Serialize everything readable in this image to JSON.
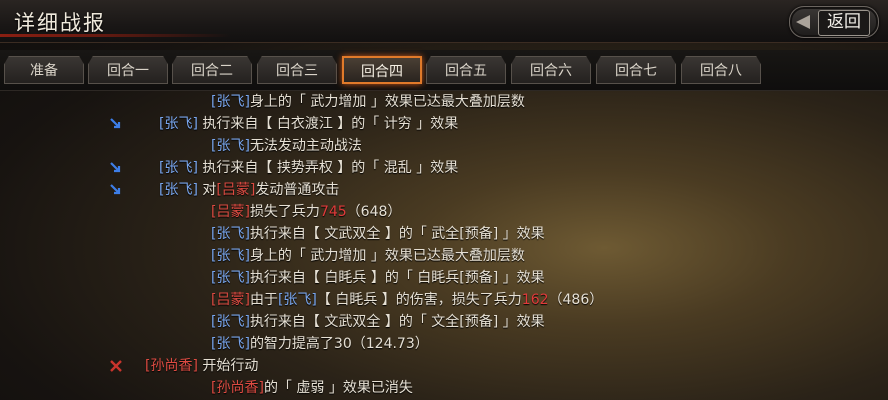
{
  "header": {
    "title": "详细战报",
    "back_label": "返回"
  },
  "tabs": [
    {
      "label": "准备",
      "active": false
    },
    {
      "label": "回合一",
      "active": false
    },
    {
      "label": "回合二",
      "active": false
    },
    {
      "label": "回合三",
      "active": false
    },
    {
      "label": "回合四",
      "active": true
    },
    {
      "label": "回合五",
      "active": false
    },
    {
      "label": "回合六",
      "active": false
    },
    {
      "label": "回合七",
      "active": false
    },
    {
      "label": "回合八",
      "active": false
    }
  ],
  "log": [
    {
      "icon": null,
      "segments": [
        {
          "t": "[张飞]",
          "c": "blue"
        },
        {
          "t": "身上的「 武力增加 」效果已达最大叠加层数",
          "c": "plain"
        }
      ]
    },
    {
      "icon": "debuff-arrow-icon",
      "segments": [
        {
          "t": "[张飞]",
          "c": "blue"
        },
        {
          "t": " 执行来自【 白衣渡江 】的「 计穷 」效果",
          "c": "plain"
        }
      ]
    },
    {
      "icon": null,
      "segments": [
        {
          "t": "[张飞]",
          "c": "blue"
        },
        {
          "t": "无法发动主动战法",
          "c": "plain"
        }
      ]
    },
    {
      "icon": "debuff-arrow-icon",
      "segments": [
        {
          "t": "[张飞]",
          "c": "blue"
        },
        {
          "t": " 执行来自【 挟势弄权 】的「 混乱 」效果",
          "c": "plain"
        }
      ]
    },
    {
      "icon": "debuff-arrow-icon",
      "segments": [
        {
          "t": "[张飞]",
          "c": "blue"
        },
        {
          "t": " 对",
          "c": "plain"
        },
        {
          "t": "[吕蒙]",
          "c": "red"
        },
        {
          "t": "发动普通攻击",
          "c": "plain"
        }
      ]
    },
    {
      "icon": null,
      "segments": [
        {
          "t": "[吕蒙]",
          "c": "red"
        },
        {
          "t": "损失了兵力",
          "c": "plain"
        },
        {
          "t": "745",
          "c": "numred"
        },
        {
          "t": "（648）",
          "c": "plain"
        }
      ]
    },
    {
      "icon": null,
      "segments": [
        {
          "t": "[张飞]",
          "c": "blue"
        },
        {
          "t": "执行来自【 文武双全 】的「 武全[预备] 」效果",
          "c": "plain"
        }
      ]
    },
    {
      "icon": null,
      "segments": [
        {
          "t": "[张飞]",
          "c": "blue"
        },
        {
          "t": "身上的「 武力增加 」效果已达最大叠加层数",
          "c": "plain"
        }
      ]
    },
    {
      "icon": null,
      "segments": [
        {
          "t": "[张飞]",
          "c": "blue"
        },
        {
          "t": "执行来自【 白眊兵 】的「 白眊兵[预备] 」效果",
          "c": "plain"
        }
      ]
    },
    {
      "icon": null,
      "segments": [
        {
          "t": "[吕蒙]",
          "c": "red"
        },
        {
          "t": "由于",
          "c": "plain"
        },
        {
          "t": "[张飞]",
          "c": "blue"
        },
        {
          "t": "【 白眊兵 】的伤害，损失了兵力",
          "c": "plain"
        },
        {
          "t": "162",
          "c": "numred"
        },
        {
          "t": "（486）",
          "c": "plain"
        }
      ]
    },
    {
      "icon": null,
      "segments": [
        {
          "t": "[张飞]",
          "c": "blue"
        },
        {
          "t": "执行来自【 文武双全 】的「 文全[预备] 」效果",
          "c": "plain"
        }
      ]
    },
    {
      "icon": null,
      "segments": [
        {
          "t": "[张飞]",
          "c": "blue"
        },
        {
          "t": "的智力提高了30（124.73）",
          "c": "plain"
        }
      ]
    },
    {
      "icon": "crossed-swords-icon",
      "segments": [
        {
          "t": "[孙尚香]",
          "c": "red"
        },
        {
          "t": " 开始行动",
          "c": "plain"
        }
      ]
    },
    {
      "icon": null,
      "segments": [
        {
          "t": "[孙尚香]",
          "c": "red"
        },
        {
          "t": "的「 虚弱 」效果已消失",
          "c": "plain"
        }
      ]
    }
  ],
  "colors": {
    "ally": "#79a6ee",
    "enemy": "#dd4b42",
    "active_tab_border": "#e07a2a"
  }
}
